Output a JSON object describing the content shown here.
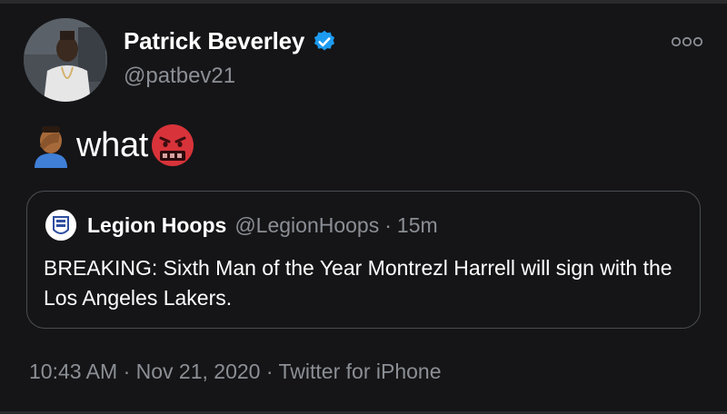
{
  "author": {
    "name": "Patrick Beverley",
    "handle": "@patbev21",
    "verified": true
  },
  "tweet": {
    "text": "what",
    "emoji_before": "person-facepalming",
    "emoji_after": "face-with-symbols-on-mouth"
  },
  "quoted_tweet": {
    "name": "Legion Hoops",
    "handle": "@LegionHoops",
    "separator": "·",
    "time": "15m",
    "text": "BREAKING: Sixth Man of the Year Montrezl Harrell will sign with the Los Angeles Lakers."
  },
  "meta": {
    "time": "10:43 AM",
    "dot1": "·",
    "date": "Nov 21, 2020",
    "dot2": "·",
    "source": "Twitter for iPhone"
  },
  "colors": {
    "background": "#151517",
    "text": "#ffffff",
    "secondary_text": "#8b8f95",
    "verified_badge": "#1d9bf0",
    "border": "#4a4d52"
  },
  "icons": {
    "more": "more-horizontal-icon",
    "verified": "verified-badge-icon"
  }
}
